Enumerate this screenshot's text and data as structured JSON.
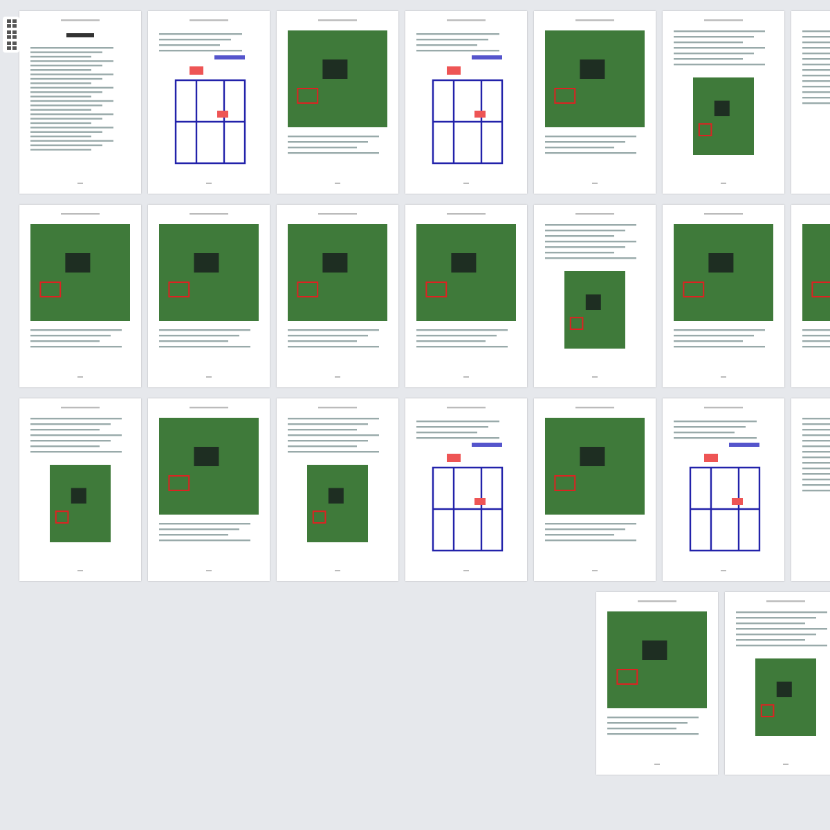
{
  "page_rows": [
    [
      {
        "kind": "toc"
      },
      {
        "kind": "schematic"
      },
      {
        "kind": "photo"
      },
      {
        "kind": "schematic"
      },
      {
        "kind": "photo"
      },
      {
        "kind": "text_photo"
      },
      {
        "kind": "text"
      }
    ],
    [
      {
        "kind": "photo"
      },
      {
        "kind": "photo"
      },
      {
        "kind": "photo"
      },
      {
        "kind": "photo"
      },
      {
        "kind": "text_photo"
      },
      {
        "kind": "photo"
      },
      {
        "kind": "photo"
      }
    ],
    [
      {
        "kind": "text_photo"
      },
      {
        "kind": "photo"
      },
      {
        "kind": "text_photo"
      },
      {
        "kind": "schematic"
      },
      {
        "kind": "photo"
      },
      {
        "kind": "schematic"
      },
      {
        "kind": "text"
      }
    ],
    [
      {
        "kind": "photo"
      },
      {
        "kind": "text_photo"
      }
    ]
  ]
}
